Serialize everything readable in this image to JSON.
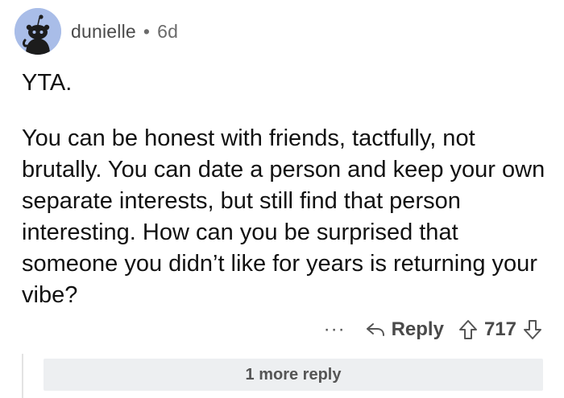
{
  "comment": {
    "author": "dunielle",
    "separator": "•",
    "age": "6d",
    "paragraphs": [
      "YTA.",
      "You can be honest with friends, tactfully, not brutally. You can date a person and keep your own separate interests, but still find that person interesting. How can you be surprised that someone you didn’t like for years is returning your vibe?"
    ],
    "actions": {
      "more": "···",
      "reply_label": "Reply",
      "vote_count": "717"
    },
    "more_replies_label": "1 more reply"
  },
  "colors": {
    "avatar_bg": "#a9bde8",
    "text": "#111111",
    "meta": "#4a4a4a",
    "more_replies_bg": "#edeff1"
  },
  "icons": [
    "reddit-snoo-avatar-icon",
    "reply-arrow-icon",
    "upvote-arrow-icon",
    "downvote-arrow-icon"
  ]
}
